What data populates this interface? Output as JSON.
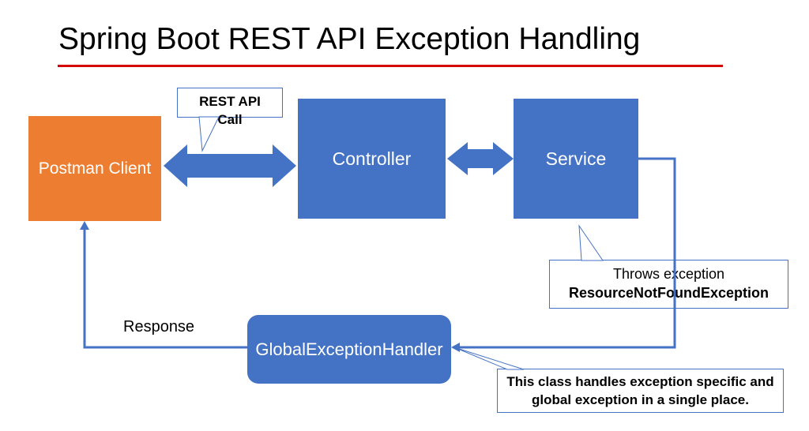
{
  "title": "Spring Boot REST API Exception Handling",
  "boxes": {
    "postman": "Postman Client",
    "controller": "Controller",
    "service": "Service",
    "handler": "GlobalExceptionHandler"
  },
  "callouts": {
    "api": "REST API Call",
    "throws_line1": "Throws exception",
    "throws_line2": "ResourceNotFoundException",
    "class_desc": "This class handles exception specific and global exception in a single place."
  },
  "labels": {
    "response": "Response"
  },
  "colors": {
    "blue": "#4472c4",
    "orange": "#ec7d31",
    "red": "#d40606"
  }
}
